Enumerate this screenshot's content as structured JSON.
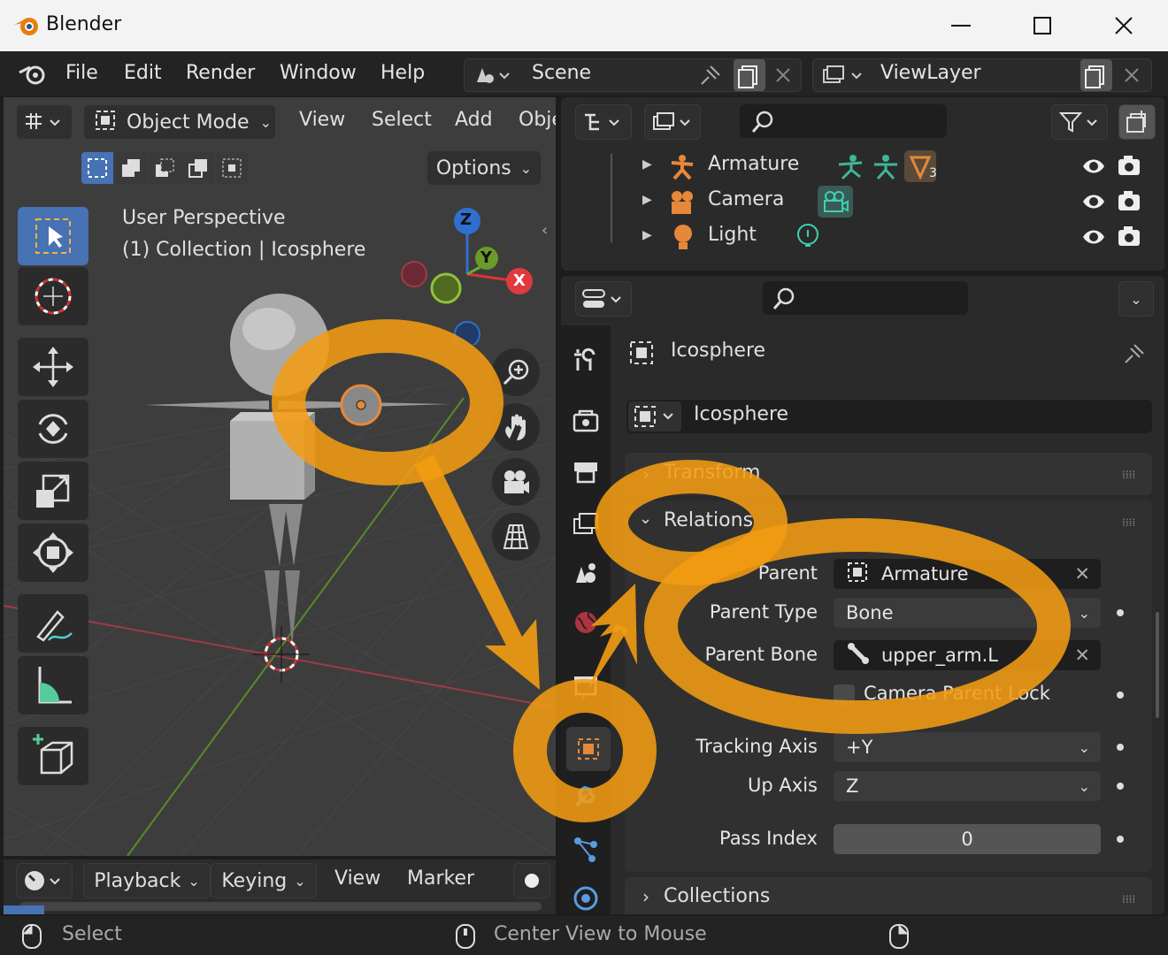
{
  "window": {
    "title": "Blender"
  },
  "topbar": {
    "menus": [
      "File",
      "Edit",
      "Render",
      "Window",
      "Help"
    ],
    "scene": "Scene",
    "view_layer": "ViewLayer"
  },
  "viewport": {
    "mode": "Object Mode",
    "menus": [
      "View",
      "Select",
      "Add",
      "Obje"
    ],
    "options": "Options",
    "overlay_title": "User Perspective",
    "overlay_subtitle": "(1) Collection | Icosphere",
    "gizmo_axes": [
      "Z",
      "Y",
      "X"
    ]
  },
  "outliner": {
    "items": [
      {
        "name": "Armature",
        "badge": "3"
      },
      {
        "name": "Camera"
      },
      {
        "name": "Light"
      }
    ]
  },
  "properties": {
    "object_name": "Icosphere",
    "data_name": "Icosphere",
    "sections": {
      "transform": "Transform",
      "relations": "Relations",
      "collections": "Collections"
    },
    "relations": {
      "parent_label": "Parent",
      "parent_value": "Armature",
      "parent_type_label": "Parent Type",
      "parent_type_value": "Bone",
      "parent_bone_label": "Parent Bone",
      "parent_bone_value": "upper_arm.L",
      "camera_lock_label": "Camera Parent Lock",
      "tracking_axis_label": "Tracking Axis",
      "tracking_axis_value": "+Y",
      "up_axis_label": "Up Axis",
      "up_axis_value": "Z",
      "pass_index_label": "Pass Index",
      "pass_index_value": "0"
    }
  },
  "timeline": {
    "menus": [
      "Playback",
      "Keying",
      "View",
      "Marker"
    ]
  },
  "statusbar": {
    "left": "Select",
    "middle": "Center View to Mouse"
  },
  "colors": {
    "annotation": "#f39c12",
    "accent": "#4772b3",
    "object_orange": "#e6883a"
  }
}
